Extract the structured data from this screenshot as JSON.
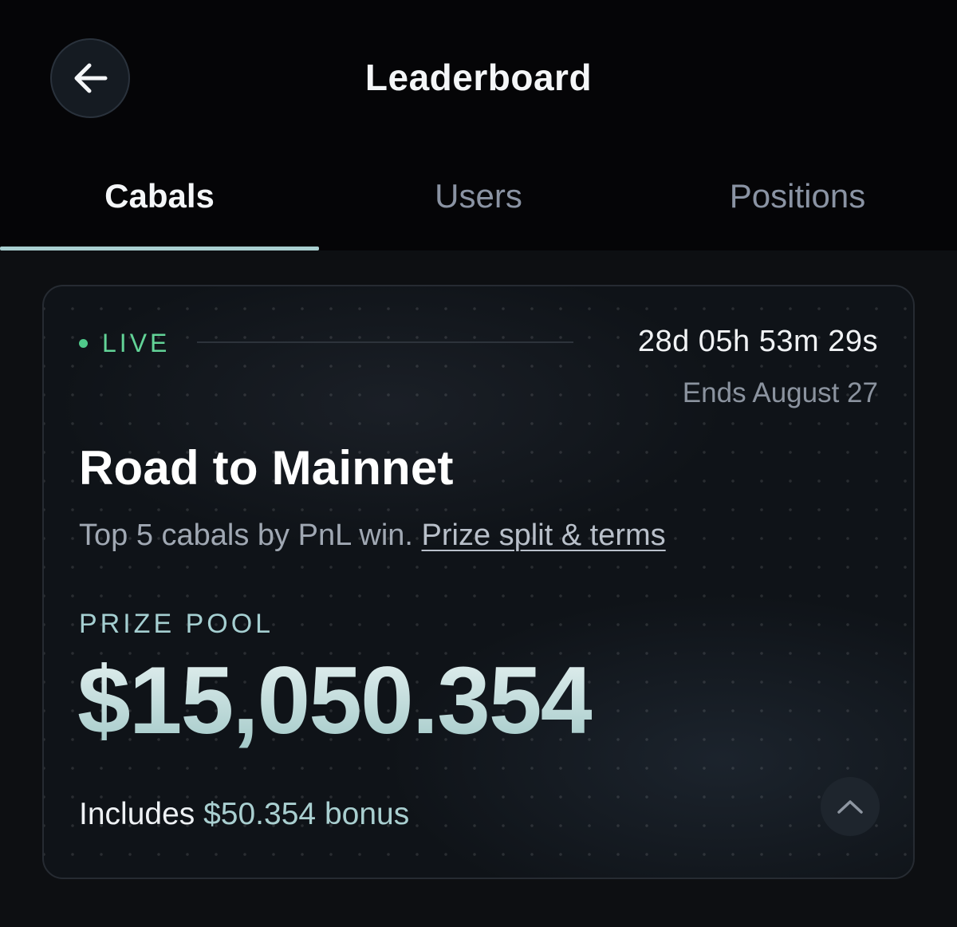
{
  "header": {
    "title": "Leaderboard",
    "back_icon": "arrow-left-icon"
  },
  "tabs": [
    {
      "label": "Cabals",
      "active": true
    },
    {
      "label": "Users",
      "active": false
    },
    {
      "label": "Positions",
      "active": false
    }
  ],
  "contest": {
    "status": "LIVE",
    "countdown": "28d 05h 53m 29s",
    "ends": "Ends August 27",
    "title": "Road to Mainnet",
    "description": "Top 5 cabals by PnL win.",
    "terms_link": "Prize split & terms",
    "prize_pool_label": "PRIZE POOL",
    "prize_pool_amount": "$15,050.354",
    "bonus_prefix": "Includes",
    "bonus_amount": "$50.354",
    "bonus_suffix": "bonus",
    "collapse_icon": "chevron-up-icon"
  },
  "colors": {
    "background": "#0d0f12",
    "live": "#62d397",
    "accent": "#a9cfd0",
    "muted": "#8b939f"
  }
}
